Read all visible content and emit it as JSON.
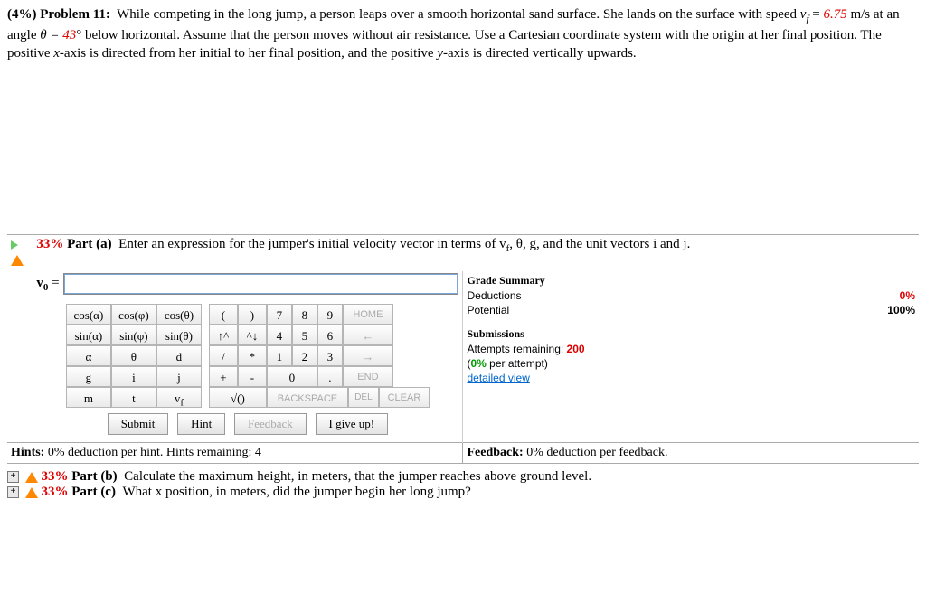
{
  "problem": {
    "weight": "(4%)",
    "label": "Problem 11:",
    "text1": "While competing in the long jump, a person leaps over a smooth horizontal sand surface. She lands on the surface with speed ",
    "vf_sym": "v",
    "vf_sub": "f",
    "vf_val": "6.75",
    "vf_unit": " m/s at an angle ",
    "theta_sym": "θ = ",
    "theta_val": "43",
    "text2": "° below horizontal. Assume that the person moves without air resistance. Use a Cartesian coordinate system with the origin at her final position. The positive ",
    "xaxis": "x",
    "text3": "-axis is directed from her initial to her final position, and the positive ",
    "yaxis": "y",
    "text4": "-axis is directed vertically upwards."
  },
  "part_a": {
    "pct": "33%",
    "label": "Part (a)",
    "question": "Enter an expression for the jumper's initial velocity vector in terms of v",
    "question_sub": "f",
    "question_tail": ", θ, g, and the unit vectors i and j.",
    "answer_prefix": "v",
    "answer_prefix_sub": "0",
    "answer_eq": " = "
  },
  "grade": {
    "title": "Grade Summary",
    "ded_label": "Deductions",
    "ded_val": "0%",
    "pot_label": "Potential",
    "pot_val": "100%",
    "subs_title": "Submissions",
    "attempts_label": "Attempts remaining:",
    "attempts_val": "200",
    "per_attempt_pct": "0%",
    "per_attempt_tail": " per attempt)",
    "detailed": "detailed view"
  },
  "keys": {
    "cos_a": "cos(α)",
    "cos_p": "cos(φ)",
    "cos_t": "cos(θ)",
    "sin_a": "sin(α)",
    "sin_p": "sin(φ)",
    "sin_t": "sin(θ)",
    "alpha": "α",
    "theta": "θ",
    "d": "d",
    "g": "g",
    "i": "i",
    "j": "j",
    "m": "m",
    "t": "t",
    "vf": "v",
    "lpar": "(",
    "rpar": ")",
    "n7": "7",
    "n8": "8",
    "n9": "9",
    "home": "HOME",
    "up": "↑^",
    "down": "^↓",
    "n4": "4",
    "n5": "5",
    "n6": "6",
    "left": "←",
    "slash": "/",
    "star": "*",
    "n1": "1",
    "n2": "2",
    "n3": "3",
    "right": "→",
    "plus": "+",
    "minus": "-",
    "n0": "0",
    "dot": ".",
    "end": "END",
    "sqrt": "√()",
    "back": "BACKSPACE",
    "del": "DEL",
    "clear": "CLEAR"
  },
  "actions": {
    "submit": "Submit",
    "hint": "Hint",
    "feedback": "Feedback",
    "giveup": "I give up!"
  },
  "hints": {
    "label": "Hints:",
    "ded": "0%",
    "tail": " deduction per hint. Hints remaining: ",
    "remaining": "4",
    "fb_label": "Feedback:",
    "fb_ded": "0%",
    "fb_tail": " deduction per feedback."
  },
  "part_b": {
    "pct": "33%",
    "label": "Part (b)",
    "text": "Calculate the maximum height, in meters, that the jumper reaches above ground level."
  },
  "part_c": {
    "pct": "33%",
    "label": "Part (c)",
    "text": "What x position, in meters, did the jumper begin her long jump?"
  }
}
